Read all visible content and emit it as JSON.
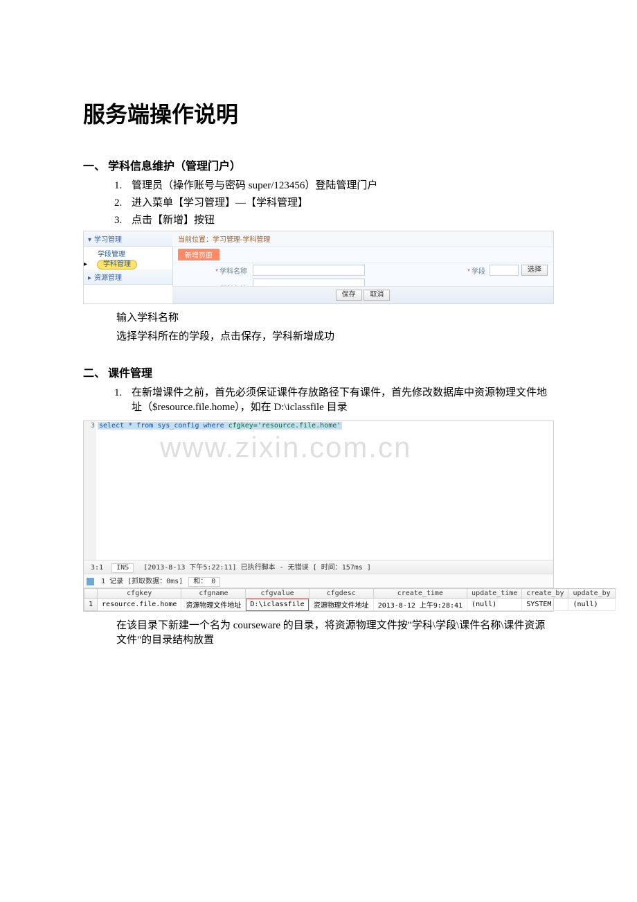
{
  "title": "服务端操作说明",
  "section1": {
    "heading": "一、    学科信息维护（管理门户）",
    "steps": [
      "管理员（操作账号与密码 super/123456）登陆管理门户",
      "进入菜单【学习管理】—【学科管理】",
      "点击【新增】按钮"
    ],
    "after1": "输入学科名称",
    "after2": "选择学科所在的学段，点击保存，学科新增成功"
  },
  "shot1": {
    "tree": {
      "group1": "学习管理",
      "item1": "学段管理",
      "item2": "学科管理",
      "group2": "资源管理"
    },
    "crumb_label": "当前位置：",
    "crumb_value": "学习管理-学科管理",
    "tab": "新增页面",
    "form": {
      "name_label": "学科名称",
      "note_label": "学科备注",
      "stage_label": "学段",
      "choose_btn": "选择"
    },
    "buttons": {
      "save": "保存",
      "cancel": "取消"
    }
  },
  "section2": {
    "heading": "二、    课件管理",
    "step1": "在新增课件之前，首先必须保证课件存放路径下有课件，首先修改数据库中资源物理文件地址（$resource.file.home），如在 D:\\iclassfile 目录",
    "after1": "在该目录下新建一个名为 courseware 的目录，将资源物理文件按\"学科\\学段\\课件名称\\课件资源文件\"的目录结构放置"
  },
  "shot2": {
    "line_no": "3",
    "sql_pre": "select * from",
    "sql_tbl": "sys_config",
    "sql_where": "where",
    "sql_cond": "cfgkey='resource.file.home'",
    "watermark": "www.zixin.com.cn",
    "status": {
      "pos": "3:1",
      "mode": "INS",
      "msg": "[2013-8-13 下午5:22:11] 已执行脚本 - 无错误 [ 时间：157ms ]"
    },
    "toolbar2": {
      "rec": "1 记录 [抓取数据：0ms]",
      "sum": "和： 0"
    },
    "table": {
      "headers": [
        "cfgkey",
        "cfgname",
        "cfgvalue",
        "cfgdesc",
        "create_time",
        "update_time",
        "create_by",
        "update_by"
      ],
      "row": {
        "idx": "1",
        "cfgkey": "resource.file.home",
        "cfgname": "资源物理文件地址",
        "cfgvalue": "D:\\iclassfile",
        "cfgdesc": "资源物理文件地址",
        "create_time": "2013-8-12 上午9:28:41",
        "update_time": "(null)",
        "create_by": "SYSTEM",
        "update_by": "(null)"
      }
    }
  }
}
